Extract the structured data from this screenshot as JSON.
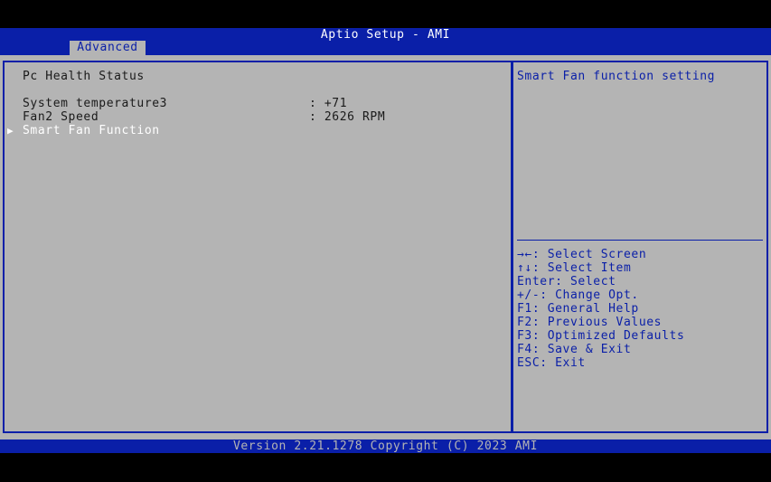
{
  "header": {
    "title": "Aptio Setup - AMI",
    "tabs": [
      {
        "label": "Advanced",
        "selected": true
      }
    ]
  },
  "left_panel": {
    "section_title": "Pc Health Status",
    "rows": [
      {
        "label": "System temperature3",
        "value": ": +71"
      },
      {
        "label": "Fan2 Speed",
        "value": ": 2626 RPM"
      }
    ],
    "submenu": {
      "marker": "▶",
      "label": "Smart Fan Function"
    }
  },
  "right_panel": {
    "help_text": "Smart Fan function setting",
    "keys": [
      "→←: Select Screen",
      "↑↓: Select Item",
      "Enter: Select",
      "+/-: Change Opt.",
      "F1: General Help",
      "F2: Previous Values",
      "F3: Optimized Defaults",
      "F4: Save & Exit",
      "ESC: Exit"
    ]
  },
  "footer": {
    "text": "Version 2.21.1278 Copyright (C) 2023 AMI"
  },
  "colors": {
    "accent": "#0a1fa8",
    "panel_bg": "#b4b4b4",
    "text": "#1a1a1a",
    "highlight": "#ffffff"
  }
}
